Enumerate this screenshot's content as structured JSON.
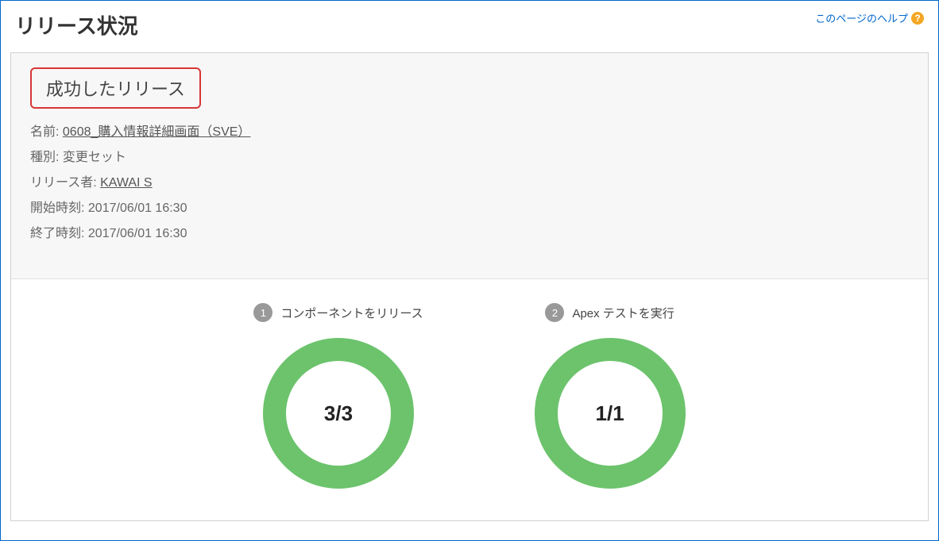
{
  "header": {
    "title": "リリース状況",
    "help_text": "このページのヘルプ",
    "help_glyph": "?"
  },
  "release": {
    "status": "成功したリリース",
    "name_label": "名前:",
    "name_value": "0608_購入情報詳細画面（SVE）",
    "type_label": "種別:",
    "type_value": "変更セット",
    "releaser_label": "リリース者:",
    "releaser_value": "KAWAI S",
    "start_label": "開始時刻:",
    "start_value": "2017/06/01 16:30",
    "end_label": "終了時刻:",
    "end_value": "2017/06/01 16:30"
  },
  "steps": {
    "components": {
      "number": "1",
      "label": "コンポーネントをリリース",
      "progress": "3/3"
    },
    "apex": {
      "number": "2",
      "label": "Apex テストを実行",
      "progress": "1/1"
    }
  }
}
